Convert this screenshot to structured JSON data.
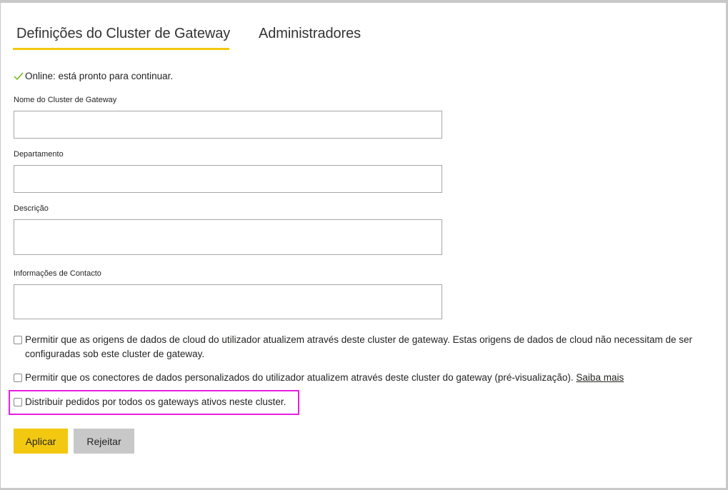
{
  "tabs": [
    {
      "label": "Definições do Cluster de Gateway",
      "active": true
    },
    {
      "label": "Administradores",
      "active": false
    }
  ],
  "status": {
    "text": "Online: está pronto para continuar.",
    "icon": "check-icon",
    "color": "#6bb700"
  },
  "fields": {
    "name": {
      "label": "Nome do Cluster de Gateway",
      "value": ""
    },
    "department": {
      "label": "Departamento",
      "value": ""
    },
    "description": {
      "label": "Descrição",
      "value": ""
    },
    "contact": {
      "label": "Informações de Contacto",
      "value": ""
    }
  },
  "options": {
    "cloud_sources": {
      "label": "Permitir que as origens de dados de cloud do utilizador atualizem através deste cluster de gateway. Estas origens de dados de cloud não necessitam de ser configuradas sob este cluster de gateway.",
      "checked": false
    },
    "custom_connectors": {
      "label": "Permitir que os conectores de dados personalizados do utilizador atualizem através deste cluster do gateway (pré-visualização).",
      "link": "Saiba mais",
      "checked": false
    },
    "distribute_requests": {
      "label": "Distribuir pedidos por todos os gateways ativos neste cluster.",
      "checked": false
    }
  },
  "buttons": {
    "apply": "Aplicar",
    "reject": "Rejeitar"
  },
  "colors": {
    "accent": "#f2c811",
    "highlight": "#e81ee0",
    "button_secondary": "#c8c8c8"
  }
}
